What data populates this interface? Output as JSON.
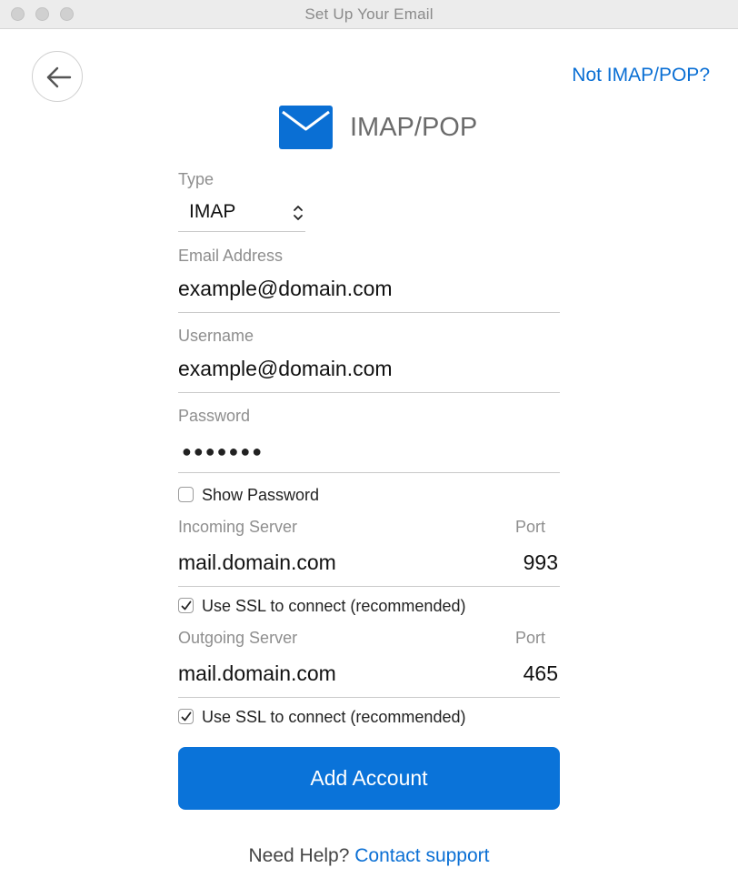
{
  "window": {
    "title": "Set Up Your Email"
  },
  "header": {
    "back_icon": "arrow-left-icon",
    "not_imap_link": "Not IMAP/POP?",
    "mail_icon": "envelope-icon",
    "title": "IMAP/POP"
  },
  "form": {
    "type": {
      "label": "Type",
      "value": "IMAP",
      "icon": "chevron-updown-icon"
    },
    "email": {
      "label": "Email Address",
      "value": "example@domain.com"
    },
    "username": {
      "label": "Username",
      "value": "example@domain.com"
    },
    "password": {
      "label": "Password",
      "masked_value": "●●●●●●●"
    },
    "show_password": {
      "label": "Show Password",
      "checked": false
    },
    "incoming": {
      "label": "Incoming Server",
      "value": "mail.domain.com",
      "port_label": "Port",
      "port": "993",
      "ssl_label": "Use SSL to connect (recommended)",
      "ssl_checked": true
    },
    "outgoing": {
      "label": "Outgoing Server",
      "value": "mail.domain.com",
      "port_label": "Port",
      "port": "465",
      "ssl_label": "Use SSL to connect (recommended)",
      "ssl_checked": true
    }
  },
  "actions": {
    "add_account": "Add Account"
  },
  "footer": {
    "help_text": "Need Help?",
    "contact_link": "Contact support"
  },
  "colors": {
    "accent": "#0a73d9",
    "link": "#0a6fd4"
  }
}
